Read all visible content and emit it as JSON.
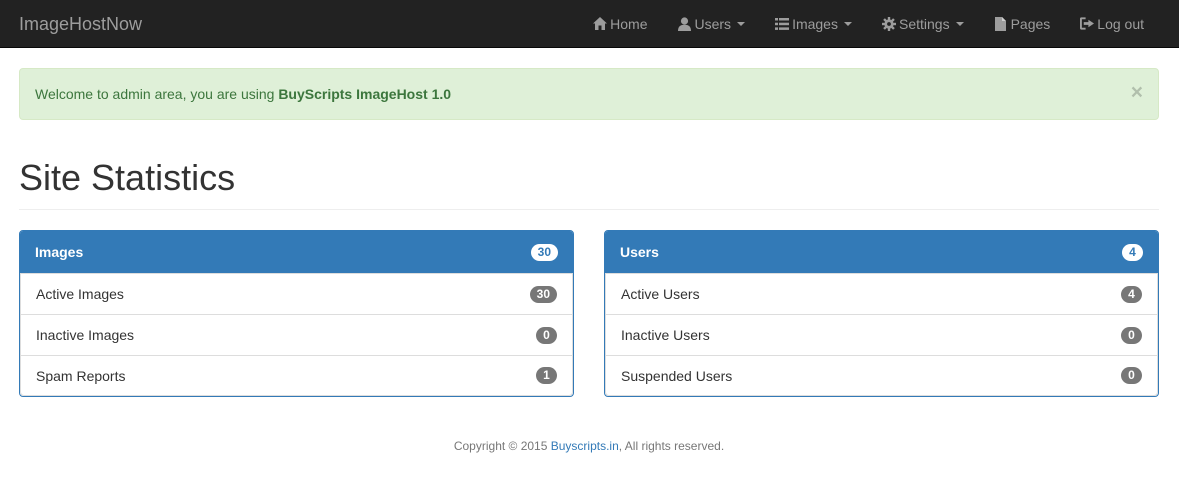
{
  "navbar": {
    "brand": "ImageHostNow",
    "items": [
      {
        "label": "Home",
        "icon": "home-icon"
      },
      {
        "label": "Users",
        "icon": "user-icon"
      },
      {
        "label": "Images",
        "icon": "list-icon"
      },
      {
        "label": "Settings",
        "icon": "gear-icon"
      },
      {
        "label": "Pages",
        "icon": "file-icon"
      },
      {
        "label": "Log out",
        "icon": "logout-icon"
      }
    ]
  },
  "alert": {
    "text": "Welcome to admin area, you are using ",
    "product": "BuyScripts ImageHost 1.0",
    "close": "×"
  },
  "page": {
    "title": "Site Statistics"
  },
  "images_panel": {
    "title": "Images",
    "count": "30",
    "rows": [
      {
        "label": "Active Images",
        "count": "30"
      },
      {
        "label": "Inactive Images",
        "count": "0"
      },
      {
        "label": "Spam Reports",
        "count": "1"
      }
    ]
  },
  "users_panel": {
    "title": "Users",
    "count": "4",
    "rows": [
      {
        "label": "Active Users",
        "count": "4"
      },
      {
        "label": "Inactive Users",
        "count": "0"
      },
      {
        "label": "Suspended Users",
        "count": "0"
      }
    ]
  },
  "footer": {
    "prefix": "Copyright © 2015 ",
    "link": "Buyscripts.in",
    "suffix": ", All rights reserved."
  },
  "colors": {
    "navbar": "#222222",
    "primary": "#337ab7",
    "alert_bg": "#dff0d8",
    "alert_text": "#3c763d",
    "badge": "#777777"
  }
}
